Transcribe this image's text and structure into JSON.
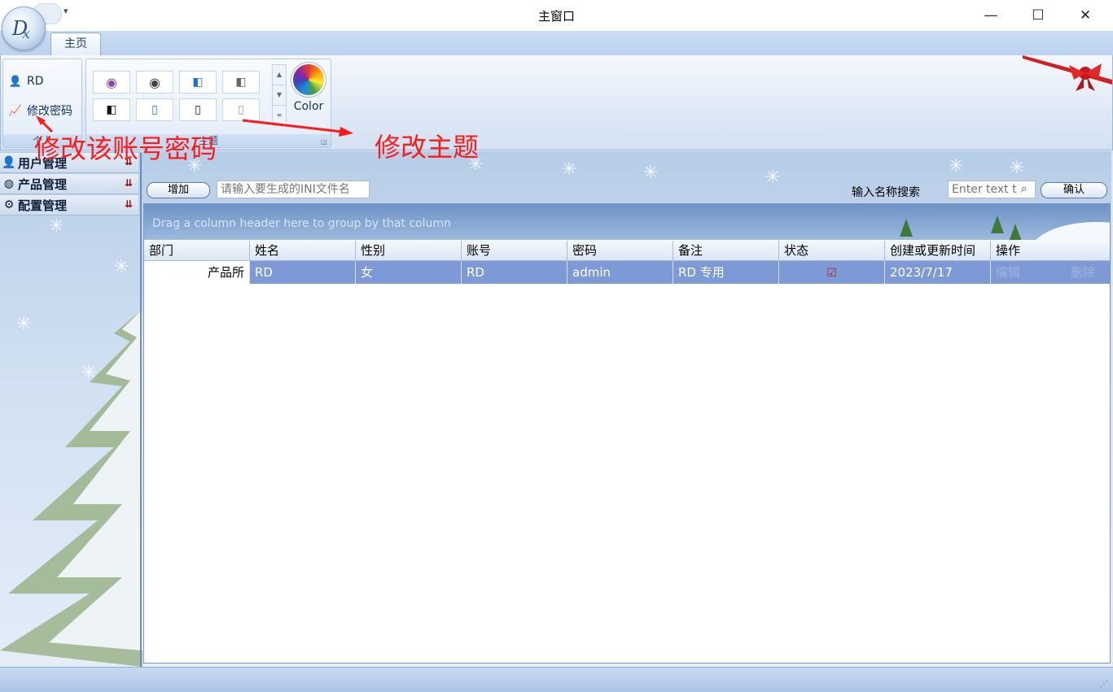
{
  "window": {
    "title": "主窗口",
    "minimize": "—",
    "maximize": "☐",
    "close": "✕"
  },
  "qat": {
    "dropdown": "▾"
  },
  "ribbon": {
    "tab": "主页",
    "personal": {
      "user": "RD",
      "change_password": "修改密码",
      "caption": "个人"
    },
    "theme": {
      "caption": "主题",
      "color_label": "Color"
    }
  },
  "annotations": {
    "password_note": "修改该账号密码",
    "theme_note": "修改主题"
  },
  "nav": {
    "items": [
      "用户管理",
      "产品管理",
      "配置管理"
    ]
  },
  "toolbar": {
    "add_label": "增加",
    "ini_placeholder": "请输入要生成的INI文件名",
    "search_label": "输入名称搜索",
    "search_placeholder": "Enter text t",
    "confirm_label": "确认"
  },
  "grid": {
    "group_hint": "Drag a column header here to group by that column",
    "columns": [
      "部门",
      "姓名",
      "性别",
      "账号",
      "密码",
      "备注",
      "状态",
      "创建或更新时间",
      "操作"
    ],
    "rows": [
      {
        "dept": "产品所",
        "name": "RD",
        "gender": "女",
        "account": "RD",
        "password": "admin",
        "note": "RD 专用",
        "status_icon": "check-icon",
        "updated": "2023/7/17",
        "edit": "编辑",
        "delete": "删除"
      }
    ]
  },
  "colors": {
    "accent": "#7d99d6",
    "annotation": "#ff1a1a",
    "ribbon": "#dfe9f6"
  }
}
